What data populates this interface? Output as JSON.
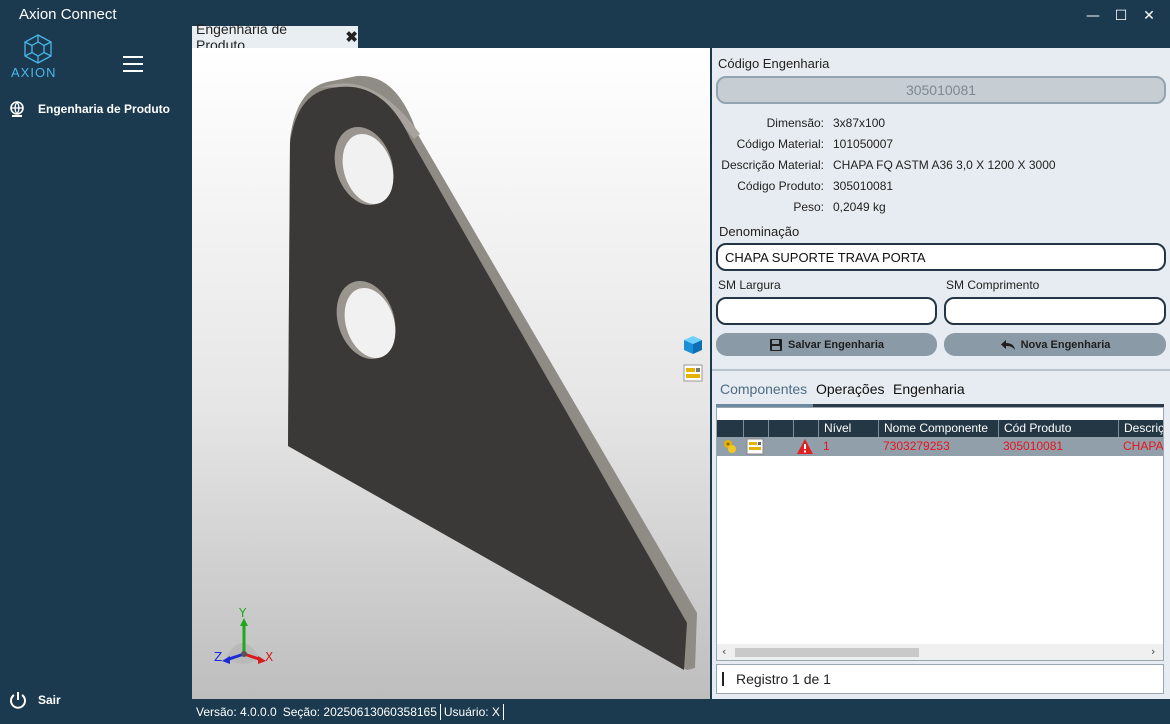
{
  "app": {
    "title": "Axion Connect",
    "logo_text": "AXION",
    "window_controls": {
      "minimize": "—",
      "maximize": "☐",
      "close": "✕"
    }
  },
  "sidebar": {
    "items": [
      {
        "label": "Engenharia de Produto",
        "icon": "globe-icon"
      }
    ],
    "exit_label": "Sair"
  },
  "document_tab": {
    "label": "Engenharia de Produto",
    "close": "✖"
  },
  "viewer": {
    "part_color": "#3b3937",
    "axes": {
      "x": "X",
      "y": "Y",
      "z": "Z"
    }
  },
  "form": {
    "code_label": "Código Engenharia",
    "code_value": "305010081",
    "info": [
      {
        "key": "Dimensão:",
        "value": "3x87x100"
      },
      {
        "key": "Código Material:",
        "value": "101050007"
      },
      {
        "key": "Descrição Material:",
        "value": "CHAPA FQ ASTM A36 3,0 X 1200 X 3000"
      },
      {
        "key": "Código Produto:",
        "value": "305010081"
      },
      {
        "key": "Peso:",
        "value": "0,2049 kg"
      }
    ],
    "denomination_label": "Denominação",
    "denomination_value": "CHAPA SUPORTE TRAVA PORTA",
    "sm_width_label": "SM Largura",
    "sm_width_value": "",
    "sm_length_label": "SM Comprimento",
    "sm_length_value": "",
    "save_button": "Salvar Engenharia",
    "new_button": "Nova Engenharia"
  },
  "tabs": [
    {
      "label": "Componentes",
      "active": true
    },
    {
      "label": "Operações",
      "active": false
    },
    {
      "label": "Engenharia",
      "active": false
    }
  ],
  "grid": {
    "columns": [
      "",
      "",
      "",
      "Nível",
      "Nome Componente",
      "Cód Produto",
      "Descriç"
    ],
    "rows": [
      {
        "nivel": "1",
        "nome": "7303279253",
        "cod": "305010081",
        "desc": "CHAPA"
      }
    ],
    "scroll_left": "‹",
    "scroll_right": "›"
  },
  "records": "Registro 1 de 1",
  "status": {
    "version": "Versão: 4.0.0.0",
    "session": "Seção: 20250613060358165",
    "user": "Usuário: X"
  }
}
